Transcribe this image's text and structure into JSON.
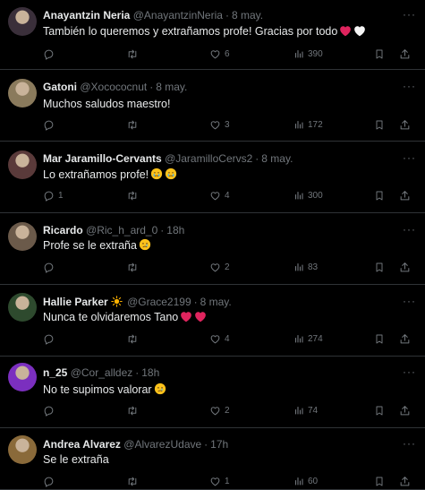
{
  "tweets": [
    {
      "name": "Anayantzin Neria",
      "handle": "@AnayantzinNeria",
      "date": "8 may.",
      "text": "También lo queremos y extrañamos profe! Gracias por todo",
      "emoji": [
        "red-heart",
        "white-heart"
      ],
      "replies": "",
      "retweets": "",
      "likes": "6",
      "views": "390",
      "avatar_color": "#3a2f3a"
    },
    {
      "name": "Gatoni",
      "handle": "@Xocococnut",
      "date": "8 may.",
      "text": "Muchos saludos maestro!",
      "emoji": [],
      "replies": "",
      "retweets": "",
      "likes": "3",
      "views": "172",
      "avatar_color": "#8a7a5c"
    },
    {
      "name": "Mar Jaramillo-Cervants",
      "handle": "@JaramilloCervs2",
      "date": "8 may.",
      "text": "Lo extrañamos profe!",
      "emoji": [
        "crying-face",
        "crying-face"
      ],
      "replies": "1",
      "retweets": "",
      "likes": "4",
      "views": "300",
      "avatar_color": "#5a3a3a"
    },
    {
      "name": "Ricardo",
      "handle": "@Ric_h_ard_0",
      "date": "18h",
      "text": "Profe se le extraña",
      "emoji": [
        "sad-face"
      ],
      "replies": "",
      "retweets": "",
      "likes": "2",
      "views": "83",
      "avatar_color": "#6b5a4a"
    },
    {
      "name": "Hallie Parker",
      "name_emoji": "sun",
      "handle": "@Grace2199",
      "date": "8 may.",
      "text": "Nunca te olvidaremos Tano",
      "emoji": [
        "red-heart",
        "red-heart"
      ],
      "replies": "",
      "retweets": "",
      "likes": "4",
      "views": "274",
      "avatar_color": "#2e4a2e"
    },
    {
      "name": "n_25",
      "handle": "@Cor_alldez",
      "date": "18h",
      "text": "No te supimos valorar",
      "emoji": [
        "sad-face"
      ],
      "replies": "",
      "retweets": "",
      "likes": "2",
      "views": "74",
      "avatar_color": "#7b2fbf"
    },
    {
      "name": "Andrea Alvarez",
      "handle": "@AlvarezUdave",
      "date": "17h",
      "text": "Se le extraña",
      "emoji": [],
      "replies": "",
      "retweets": "",
      "likes": "1",
      "views": "60",
      "avatar_color": "#8a6a3a"
    }
  ],
  "colors": {
    "background": "#000000",
    "text": "#e7e9ea",
    "muted": "#71767b",
    "divider": "#2f3336",
    "heart": "#e0245e"
  }
}
